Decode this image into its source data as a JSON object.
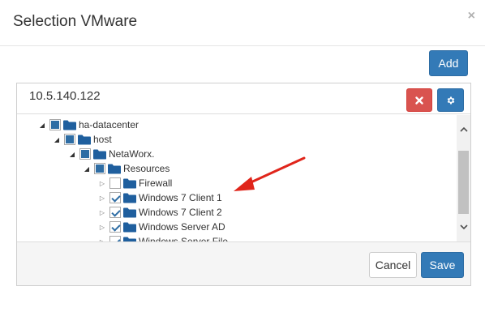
{
  "dialog": {
    "title": "Selection VMware",
    "close_glyph": "×",
    "add_label": "Add"
  },
  "panel": {
    "ip": "10.5.140.122",
    "remove_icon": "times-icon",
    "settings_icon": "gear-icon",
    "cancel_label": "Cancel",
    "save_label": "Save"
  },
  "tree": [
    {
      "label": "ha-datacenter",
      "state": "partial",
      "expanded": true
    },
    {
      "label": "host",
      "state": "partial",
      "expanded": true
    },
    {
      "label": "NetaWorx.",
      "state": "partial",
      "expanded": true
    },
    {
      "label": "Resources",
      "state": "partial",
      "expanded": true
    },
    {
      "label": "Firewall",
      "state": "unchecked",
      "expanded": false
    },
    {
      "label": "Windows 7 Client 1",
      "state": "checked",
      "expanded": false
    },
    {
      "label": "Windows 7 Client 2",
      "state": "checked",
      "expanded": false
    },
    {
      "label": "Windows Server AD",
      "state": "checked",
      "expanded": false
    },
    {
      "label": "Windows Server File",
      "state": "checked",
      "expanded": false
    }
  ],
  "colors": {
    "primary": "#337ab7",
    "danger": "#d9534f",
    "folder": "#1f5f9e",
    "annotation_arrow": "#e0251b"
  }
}
